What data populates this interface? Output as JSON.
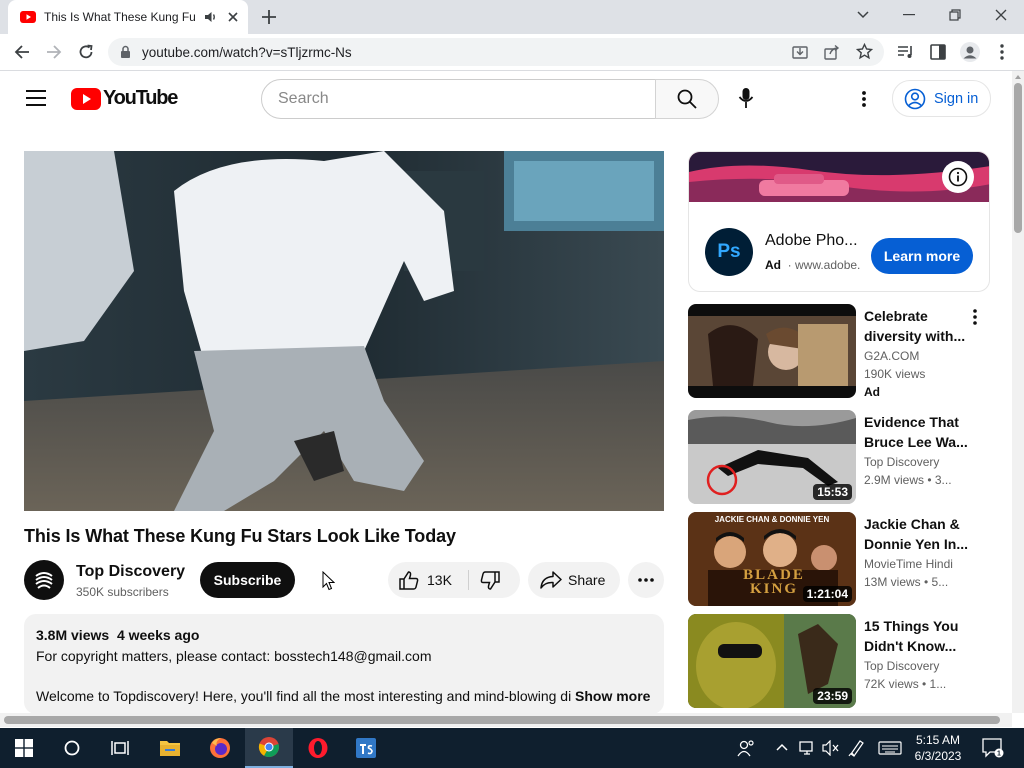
{
  "browser": {
    "tab_title": "This Is What These Kung Fu Stars Look Like Today",
    "url": "youtube.com/watch?v=sTljzrmc-Ns"
  },
  "masthead": {
    "logo_text": "YouTube",
    "search_placeholder": "Search",
    "signin_label": "Sign in"
  },
  "video": {
    "title": "This Is What These Kung Fu Stars Look Like Today",
    "channel": "Top Discovery",
    "subscribers": "350K subscribers",
    "subscribe_label": "Subscribe",
    "likes": "13K",
    "share_label": "Share"
  },
  "description": {
    "views": "3.8M views",
    "age": "4 weeks ago",
    "line1": "For copyright matters, please contact: bosstech148@gmail.com",
    "line2": "Welcome to Topdiscovery! Here, you'll find all the most interesting and mind-blowing di",
    "show_more": "Show more"
  },
  "ad": {
    "logo_text": "Ps",
    "title": "Adobe Pho...",
    "badge": "Ad",
    "domain": "www.adobe.",
    "cta": "Learn more"
  },
  "recommendations": [
    {
      "title": "Celebrate diversity with...",
      "channel": "G2A.COM",
      "views": "190K views",
      "extra": "Ad",
      "duration": ""
    },
    {
      "title": "Evidence That Bruce Lee Wa...",
      "channel": "Top Discovery",
      "views": "2.9M views  • 3...",
      "extra": "",
      "duration": "15:53"
    },
    {
      "title": "Jackie Chan & Donnie Yen In...",
      "channel": "MovieTime Hindi",
      "views": "13M views  • 5...",
      "extra": "",
      "duration": "1:21:04",
      "poster_top": "JACKIE CHAN & DONNIE YEN",
      "poster_title": "BLADE KING"
    },
    {
      "title": "15 Things You Didn't Know...",
      "channel": "Top Discovery",
      "views": "72K views  • 1...",
      "extra": "",
      "duration": "23:59"
    }
  ],
  "taskbar": {
    "time": "5:15 AM",
    "date": "6/3/2023"
  },
  "colors": {
    "youtube_red": "#ff0000",
    "link_blue": "#065fd4",
    "taskbar": "#0f1f2e"
  }
}
